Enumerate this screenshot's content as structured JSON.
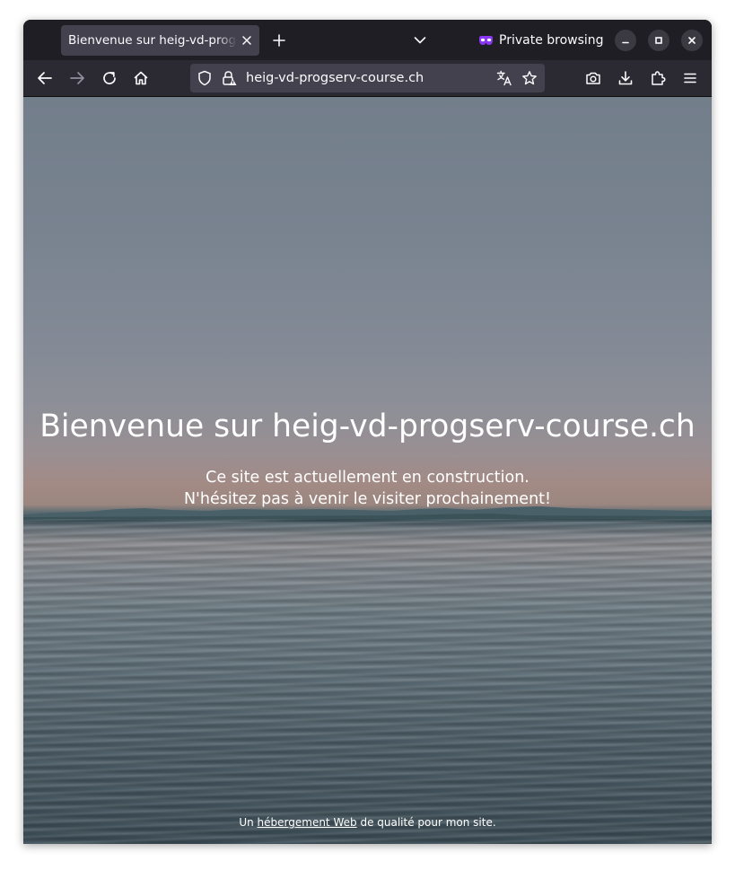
{
  "browser": {
    "tab_title": "Bienvenue sur heig-vd-progserv-course.ch",
    "private_label": "Private browsing",
    "url": "heig-vd-progserv-course.ch",
    "icons": {
      "private": "private-mask-icon",
      "back": "arrow-left-icon",
      "forward": "arrow-right-icon",
      "reload": "reload-icon",
      "home": "home-icon",
      "tracking_shield": "shield-icon",
      "lock": "lock-warning-icon",
      "translate": "translate-icon",
      "bookmark": "star-icon",
      "screenshot": "camera-icon",
      "downloads": "download-icon",
      "extensions": "puzzle-icon",
      "menu": "hamburger-icon"
    },
    "colors": {
      "tabbar": "#1f1e25",
      "toolbar": "#2b2a33",
      "urlbar": "#42414d",
      "private_accent": "#8b38f5"
    }
  },
  "page": {
    "headline": "Bienvenue sur heig-vd-progserv-course.ch",
    "line1": "Ce site est actuellement en construction.",
    "line2": "N'hésitez pas à venir le visiter prochainement!",
    "footer_prefix": "Un",
    "footer_link": "hébergement Web",
    "footer_suffix": "de qualité pour mon site."
  }
}
